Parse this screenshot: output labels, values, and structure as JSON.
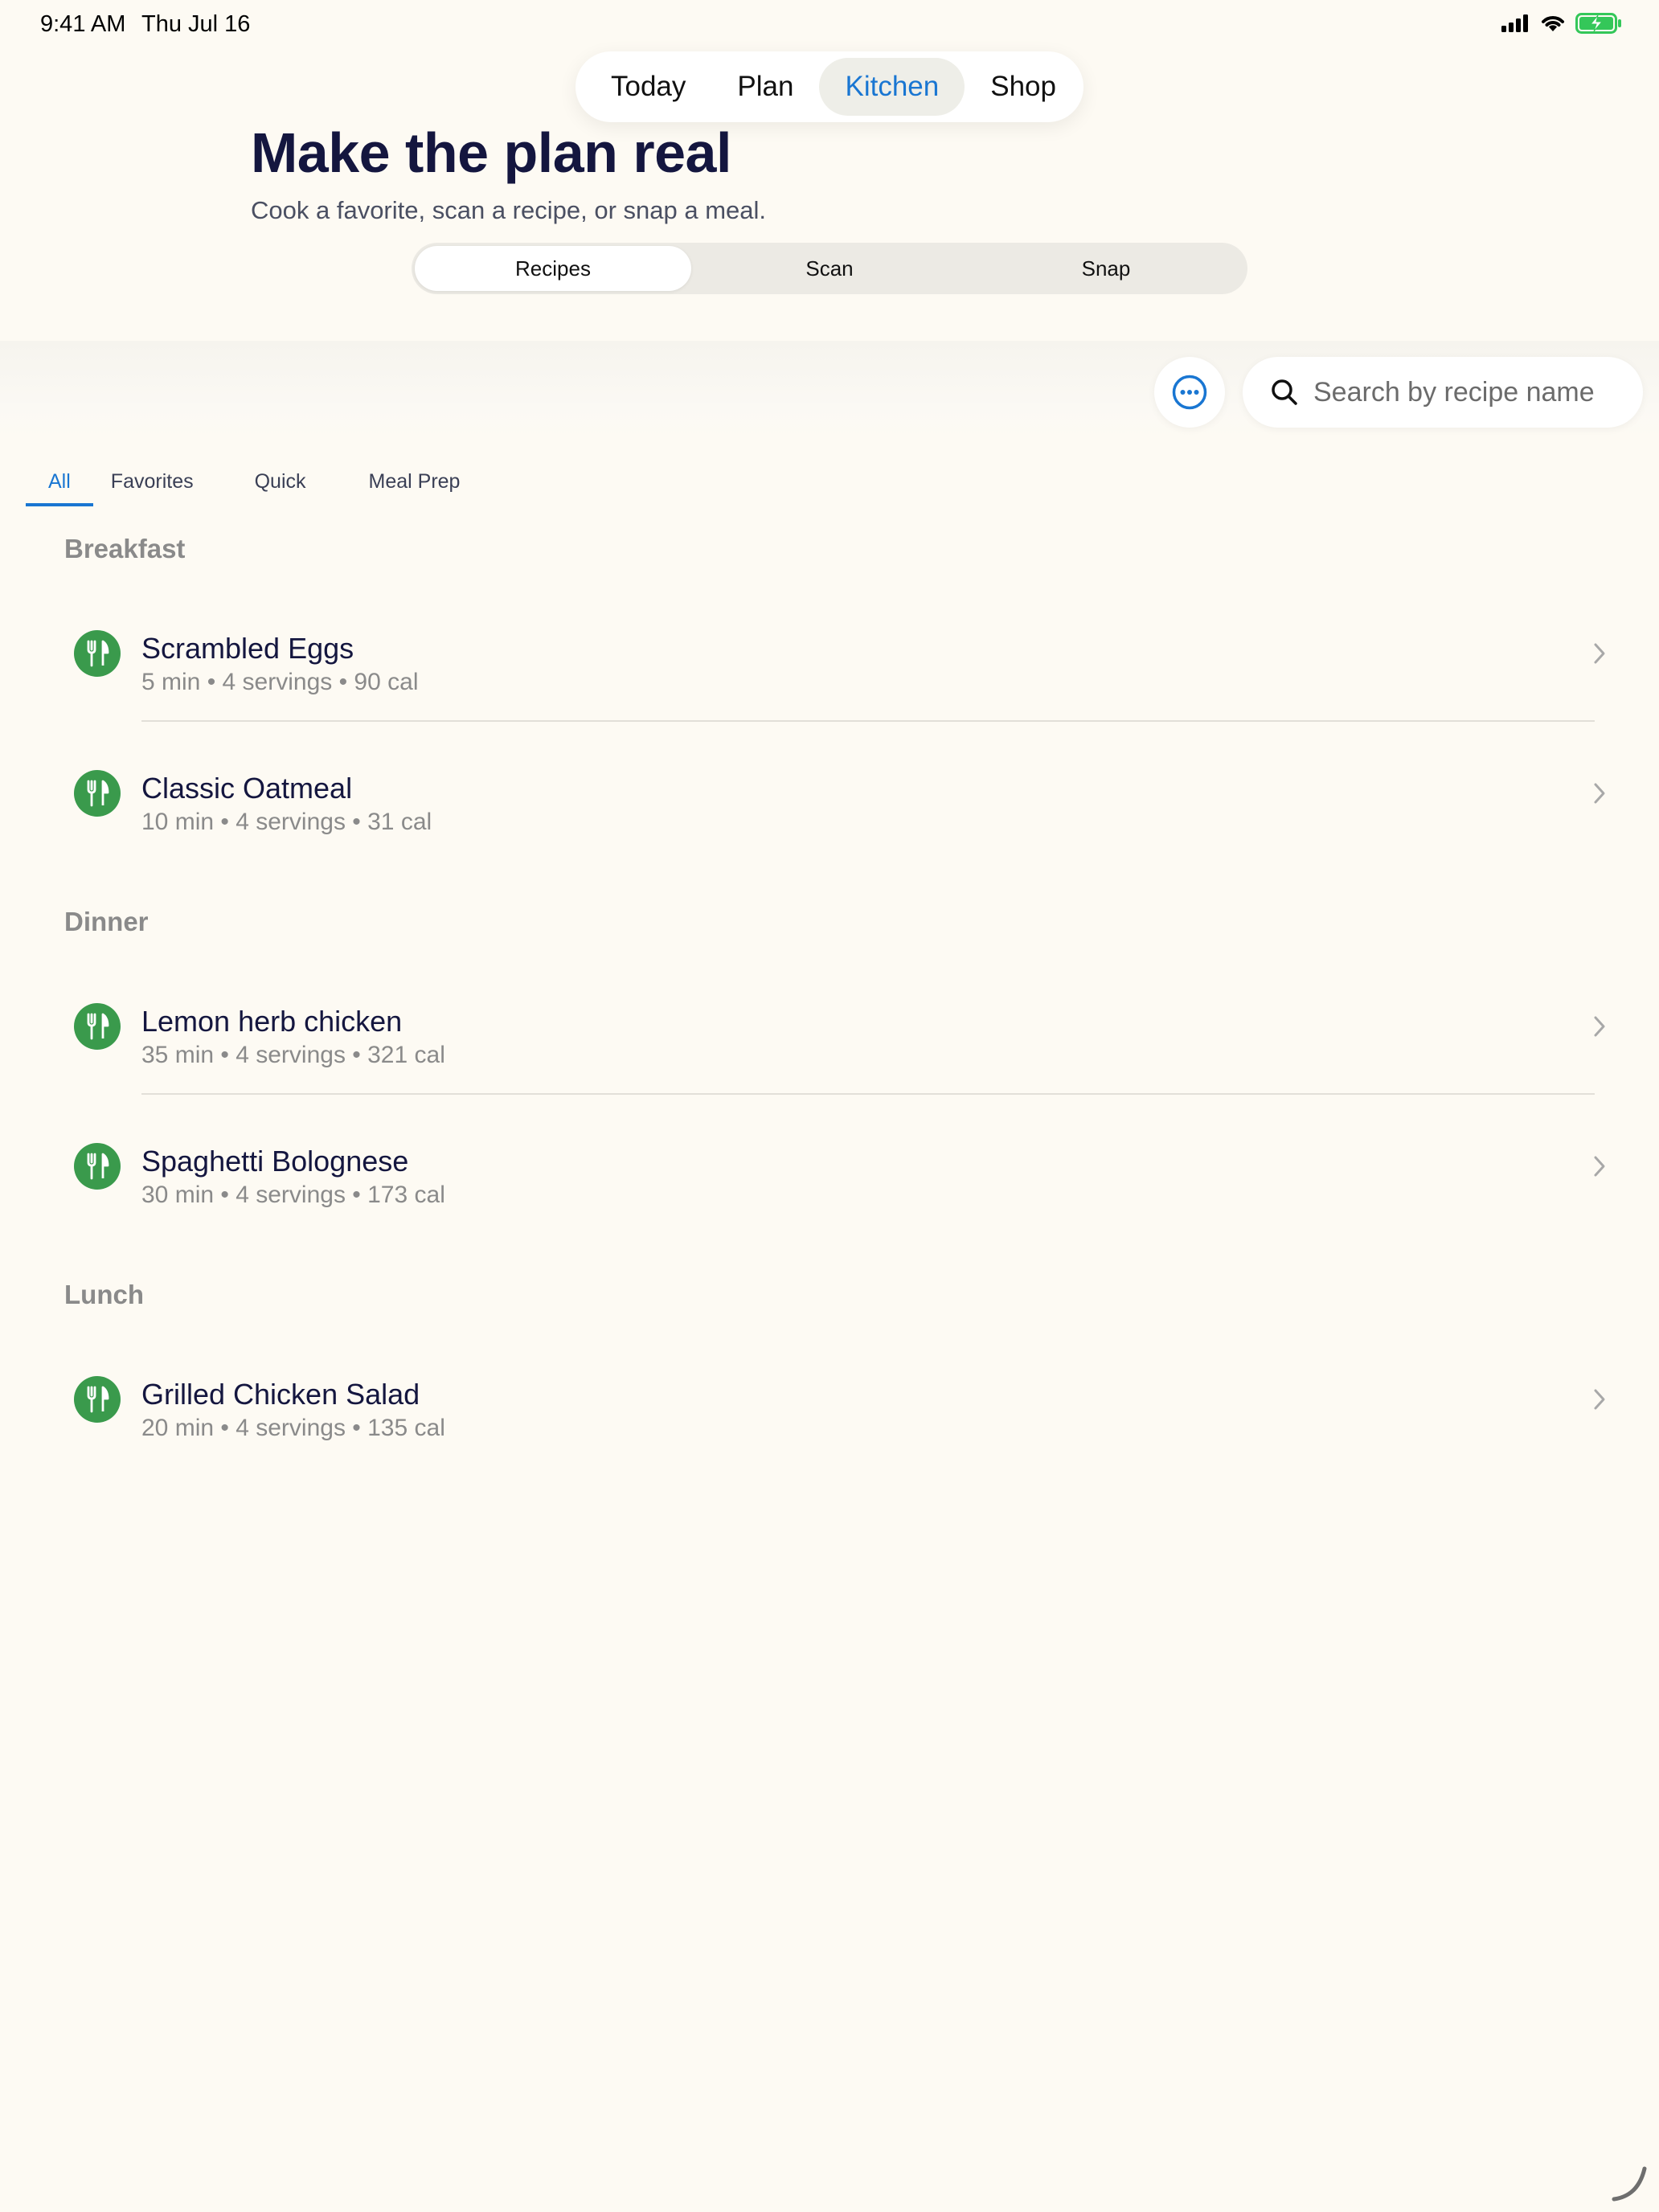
{
  "status_bar": {
    "time": "9:41 AM",
    "date": "Thu Jul 16"
  },
  "top_nav": [
    {
      "label": "Today"
    },
    {
      "label": "Plan"
    },
    {
      "label": "Kitchen"
    },
    {
      "label": "Shop"
    }
  ],
  "header": {
    "title": "Make the plan real",
    "subtitle": "Cook a favorite, scan a recipe, or snap a meal."
  },
  "segments": [
    {
      "label": "Recipes"
    },
    {
      "label": "Scan"
    },
    {
      "label": "Snap"
    }
  ],
  "search": {
    "placeholder": "Search by recipe name",
    "value": ""
  },
  "filters": [
    {
      "label": "All"
    },
    {
      "label": "Favorites"
    },
    {
      "label": "Quick"
    },
    {
      "label": "Meal Prep"
    }
  ],
  "sections": [
    {
      "title": "Breakfast",
      "recipes": [
        {
          "name": "Scrambled Eggs",
          "meta": "5 min • 4 servings • 90 cal"
        },
        {
          "name": "Classic Oatmeal",
          "meta": "10 min • 4 servings • 31 cal"
        }
      ]
    },
    {
      "title": "Dinner",
      "recipes": [
        {
          "name": "Lemon herb chicken",
          "meta": "35 min • 4 servings • 321 cal"
        },
        {
          "name": "Spaghetti Bolognese",
          "meta": "30 min • 4 servings • 173 cal"
        }
      ]
    },
    {
      "title": "Lunch",
      "recipes": [
        {
          "name": "Grilled Chicken Salad",
          "meta": "20 min • 4 servings • 135 cal"
        }
      ]
    }
  ],
  "colors": {
    "accent": "#1976d2",
    "recipe_icon": "#3a9a4c",
    "title": "#14163f",
    "background": "#fdfaf3"
  },
  "icons": [
    "cellular-signal-icon",
    "wifi-icon",
    "battery-charging-icon",
    "more-icon",
    "search-icon",
    "fork-knife-icon",
    "chevron-right-icon"
  ]
}
